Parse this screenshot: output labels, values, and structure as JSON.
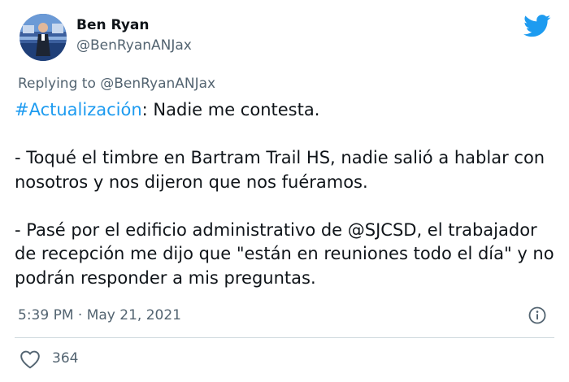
{
  "author": {
    "name": "Ben Ryan",
    "handle": "@BenRyanANJax"
  },
  "reply": {
    "prefix": "Replying to ",
    "mention": "@BenRyanANJax"
  },
  "tweet": {
    "hashtag": "#Actualización",
    "line1_rest": ": Nadie me contesta.",
    "para2": "- Toqué el timbre en Bartram Trail HS, nadie salió a hablar con nosotros y nos dijeron que nos fuéramos.",
    "para3": "- Pasé por el edificio administrativo de @SJCSD, el trabajador de recepción me dijo que \"están en reuniones todo el día\" y no podrán responder a mis preguntas."
  },
  "meta": {
    "timestamp": "5:39 PM · May 21, 2021"
  },
  "actions": {
    "like_count": "364"
  },
  "colors": {
    "accent": "#1d9bf0",
    "secondary_text": "#536471"
  },
  "icons": {
    "logo": "twitter-bird-icon",
    "info": "info-icon",
    "like": "heart-icon"
  }
}
